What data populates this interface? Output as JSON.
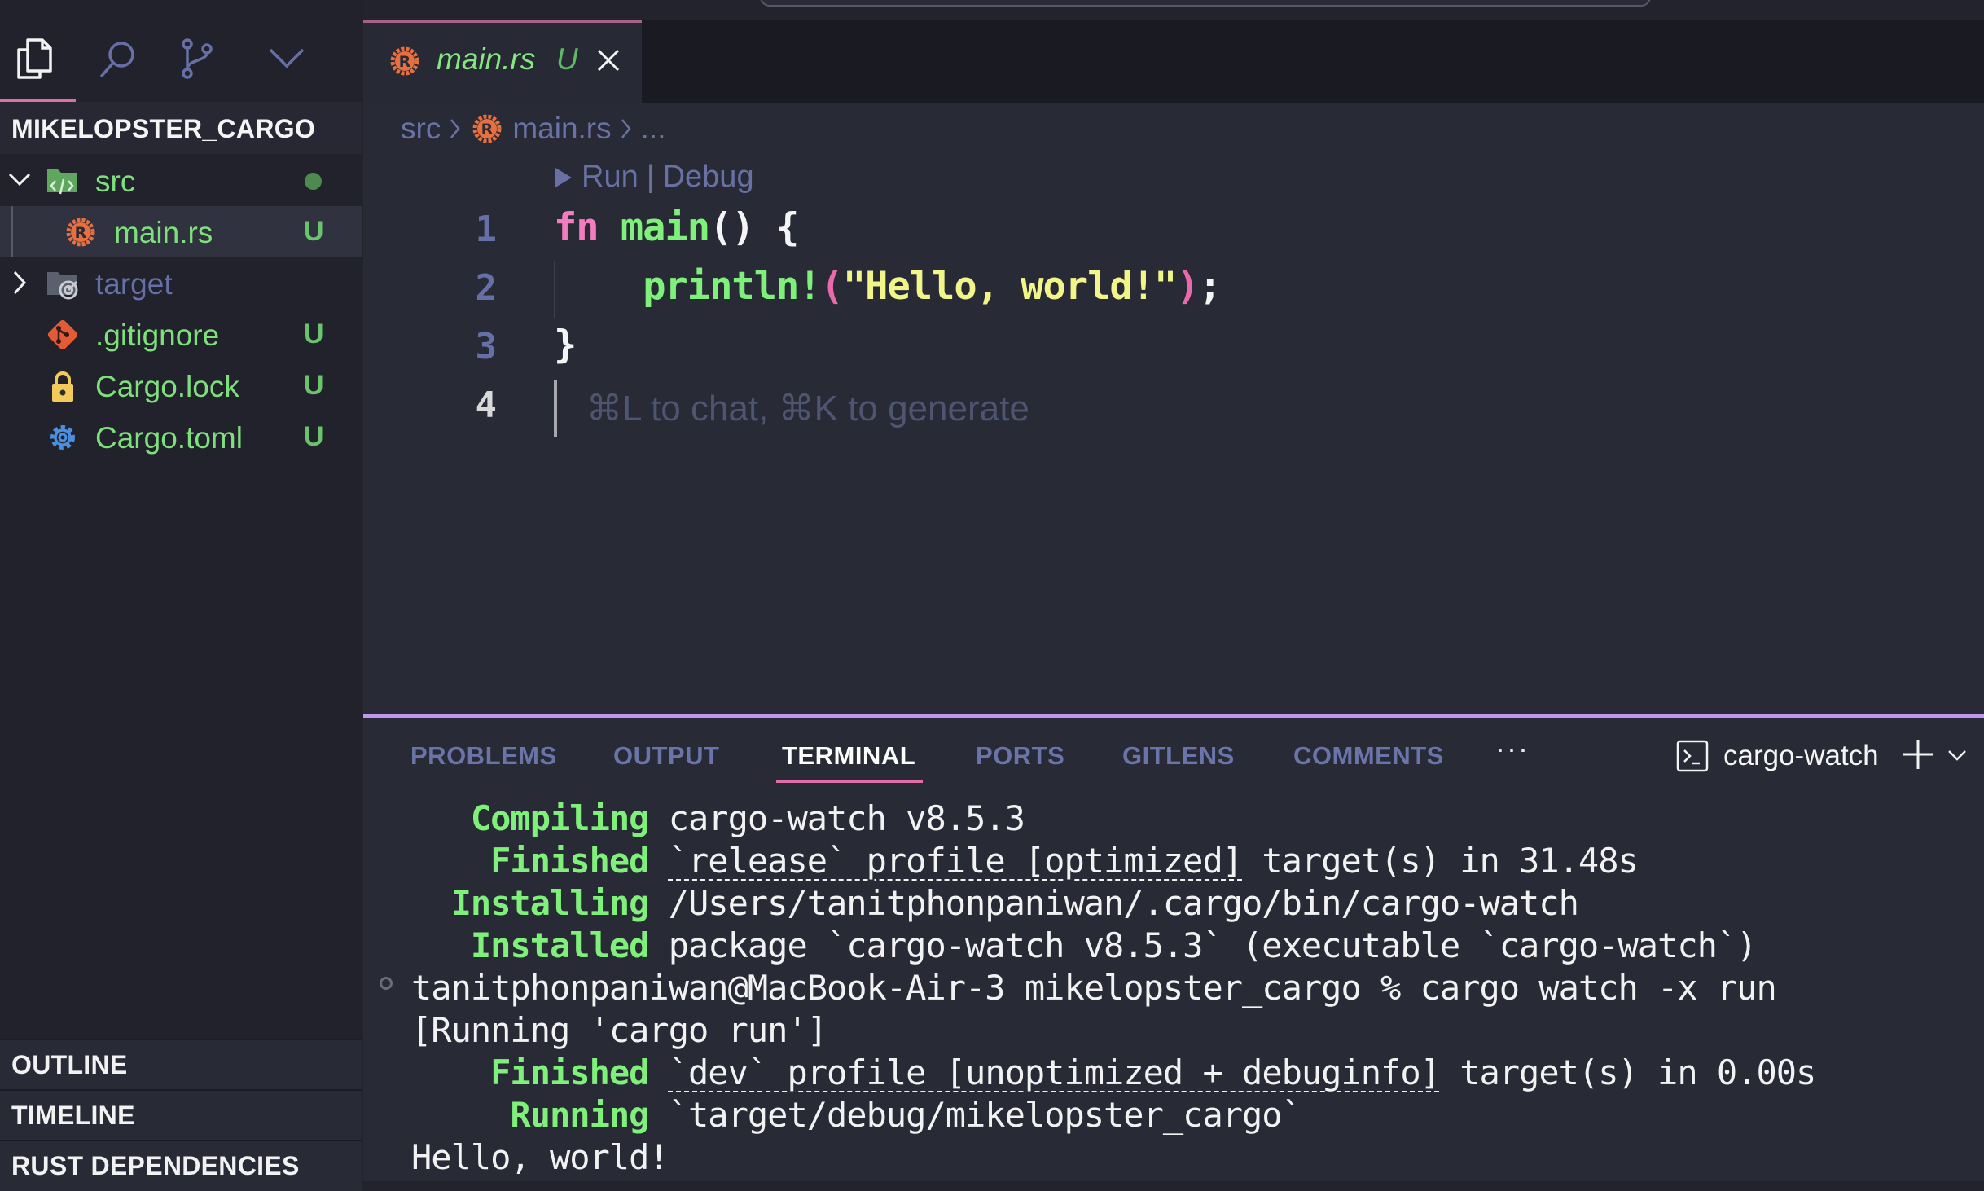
{
  "activity_bar": {
    "icons": [
      "explorer-icon",
      "search-icon",
      "source-control-icon",
      "more-views-chevron-icon"
    ],
    "active": "explorer-icon"
  },
  "explorer": {
    "title": "MIKELOPSTER_CARGO",
    "tree": [
      {
        "name": "src",
        "type": "folder",
        "expanded": true,
        "icon": "folder-src-icon",
        "decoration": "dot",
        "status_color": "#4e8a4f"
      },
      {
        "name": "main.rs",
        "type": "file",
        "icon": "rust-icon",
        "badge": "U",
        "selected": true
      },
      {
        "name": "target",
        "type": "folder",
        "expanded": false,
        "icon": "folder-target-icon",
        "badge": ""
      },
      {
        "name": ".gitignore",
        "type": "file",
        "icon": "git-icon",
        "badge": "U"
      },
      {
        "name": "Cargo.lock",
        "type": "file",
        "icon": "lock-icon",
        "badge": "U"
      },
      {
        "name": "Cargo.toml",
        "type": "file",
        "icon": "gear-icon",
        "badge": "U"
      }
    ],
    "sections": [
      "OUTLINE",
      "TIMELINE",
      "RUST DEPENDENCIES"
    ]
  },
  "editor": {
    "tab": {
      "label": "main.rs",
      "badge": "U"
    },
    "breadcrumb": [
      "src",
      "main.rs",
      "..."
    ],
    "codelens": {
      "run": "Run",
      "separator": "|",
      "debug": "Debug"
    },
    "line_numbers": [
      "1",
      "2",
      "3",
      "4"
    ],
    "code": {
      "line1": {
        "kw": "fn",
        "name": "main",
        "rest": "() {"
      },
      "line2": {
        "indent": "    ",
        "macro": "println!",
        "open": "(",
        "string": "\"Hello, world!\"",
        "close": ")",
        "end": ";"
      },
      "line3": "}"
    },
    "ghost_hint": "⌘L to chat, ⌘K to generate"
  },
  "panel": {
    "tabs": [
      "PROBLEMS",
      "OUTPUT",
      "TERMINAL",
      "PORTS",
      "GITLENS",
      "COMMENTS"
    ],
    "active_tab": "TERMINAL",
    "more": "···",
    "terminal_name": "cargo-watch",
    "terminal_lines": [
      {
        "status": "   Compiling",
        "text": " cargo-watch v8.5.3"
      },
      {
        "status": "    Finished",
        "underlined": "`release` profile [optimized]",
        "text": " target(s) in 31.48s"
      },
      {
        "status": "  Installing",
        "text": " /Users/tanitphonpaniwan/.cargo/bin/cargo-watch"
      },
      {
        "status": "   Installed",
        "text": " package `cargo-watch v8.5.3` (executable `cargo-watch`)"
      },
      {
        "prompt": "tanitphonpaniwan@MacBook-Air-3 mikelopster_cargo % cargo watch -x run"
      },
      {
        "plain": "[Running 'cargo run']"
      },
      {
        "status": "    Finished",
        "underlined": "`dev` profile [unoptimized + debuginfo]",
        "text": " target(s) in 0.00s"
      },
      {
        "status": "     Running",
        "text": " `target/debug/mikelopster_cargo`"
      },
      {
        "plain": "Hello, world!"
      }
    ]
  }
}
